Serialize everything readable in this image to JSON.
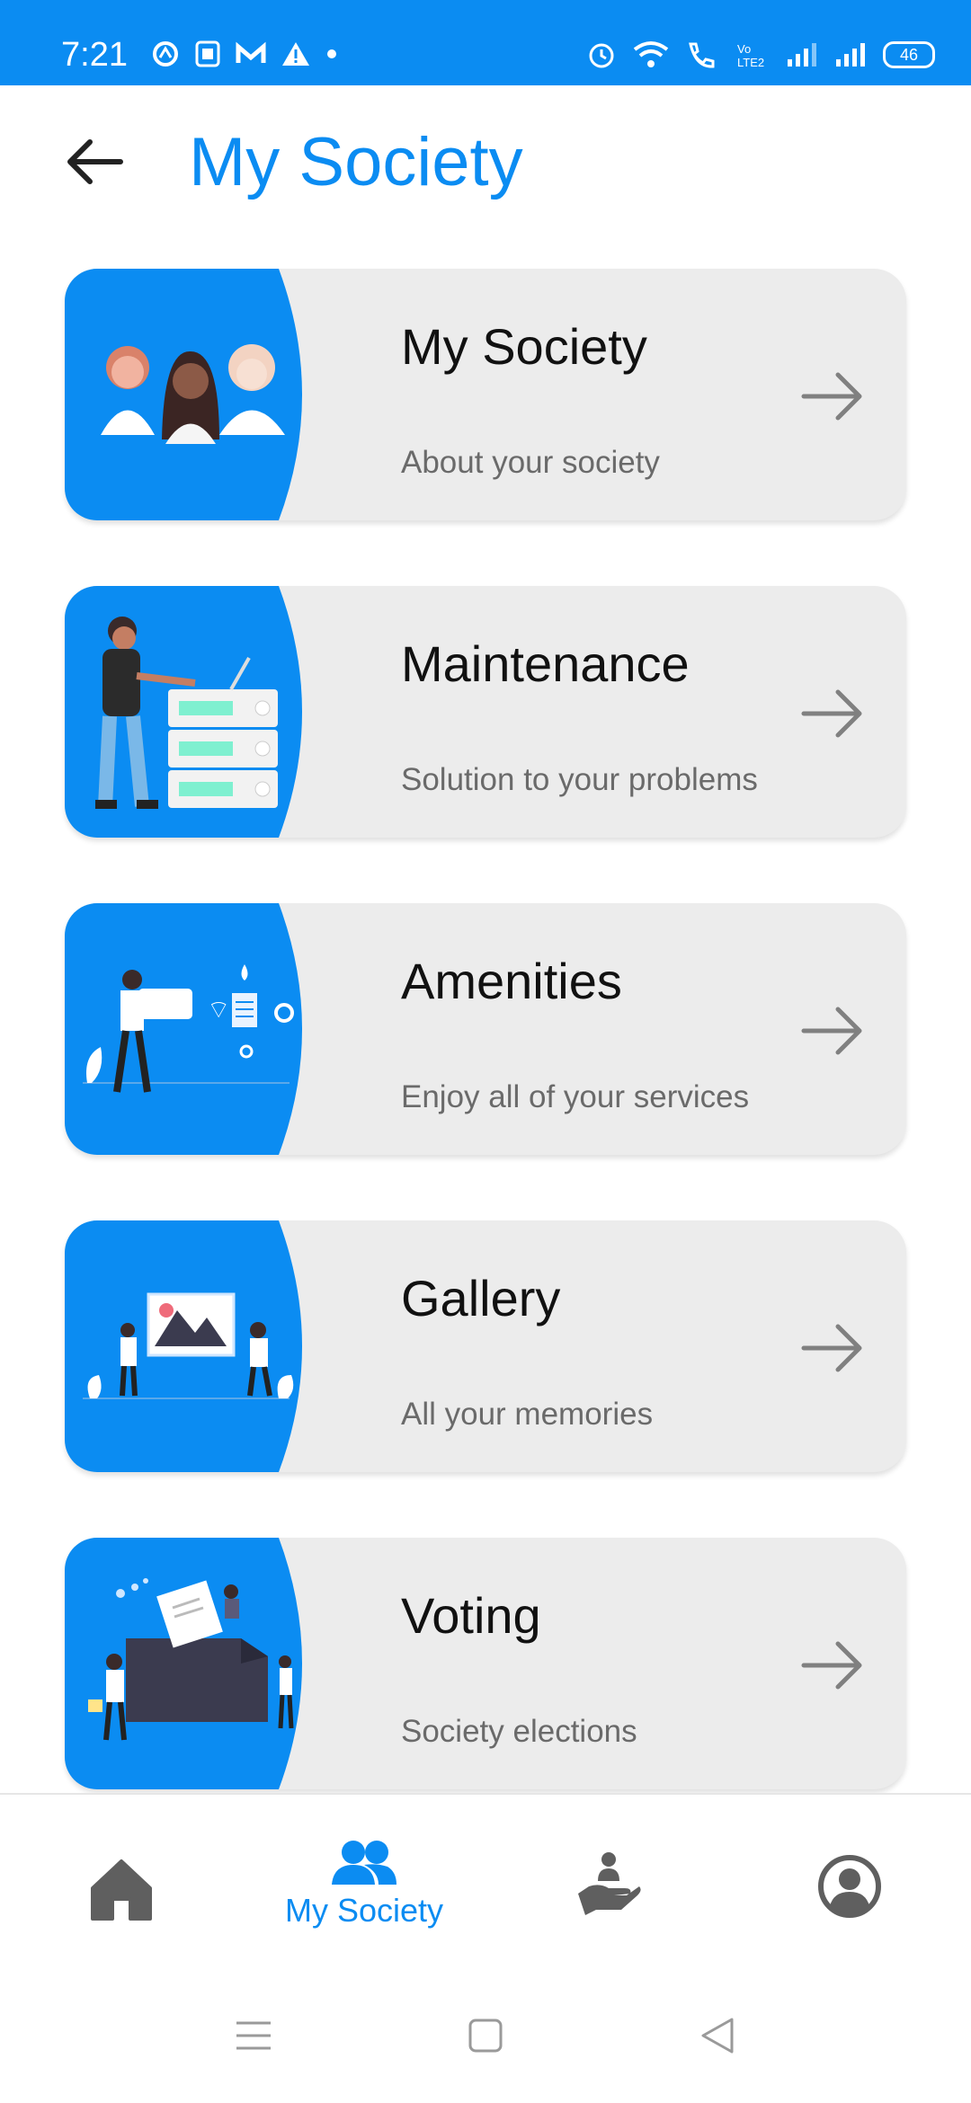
{
  "status_bar": {
    "time": "7:21",
    "battery": "46",
    "left_icons": [
      "sync-icon",
      "sim-icon",
      "gmail-icon",
      "alert-icon",
      "dot-icon"
    ],
    "right_icons": [
      "alarm-icon",
      "wifi-icon",
      "wifi-call-icon",
      "volte-icon",
      "signal-icon",
      "signal-icon"
    ]
  },
  "app_bar": {
    "title": "My Society"
  },
  "cards": [
    {
      "title": "My Society",
      "subtitle": "About your society"
    },
    {
      "title": "Maintenance",
      "subtitle": "Solution to your problems"
    },
    {
      "title": "Amenities",
      "subtitle": "Enjoy all of your services"
    },
    {
      "title": "Gallery",
      "subtitle": "All your memories"
    },
    {
      "title": "Voting",
      "subtitle": "Society elections"
    }
  ],
  "bottom_nav": {
    "items": [
      {
        "icon": "home-icon",
        "label": ""
      },
      {
        "icon": "people-icon",
        "label": "My Society",
        "active": true
      },
      {
        "icon": "help-hand-icon",
        "label": ""
      },
      {
        "icon": "profile-icon",
        "label": ""
      }
    ]
  },
  "colors": {
    "accent": "#0b8cf2",
    "card_bg": "#ececec",
    "icon_gray": "#5f5f5f"
  }
}
